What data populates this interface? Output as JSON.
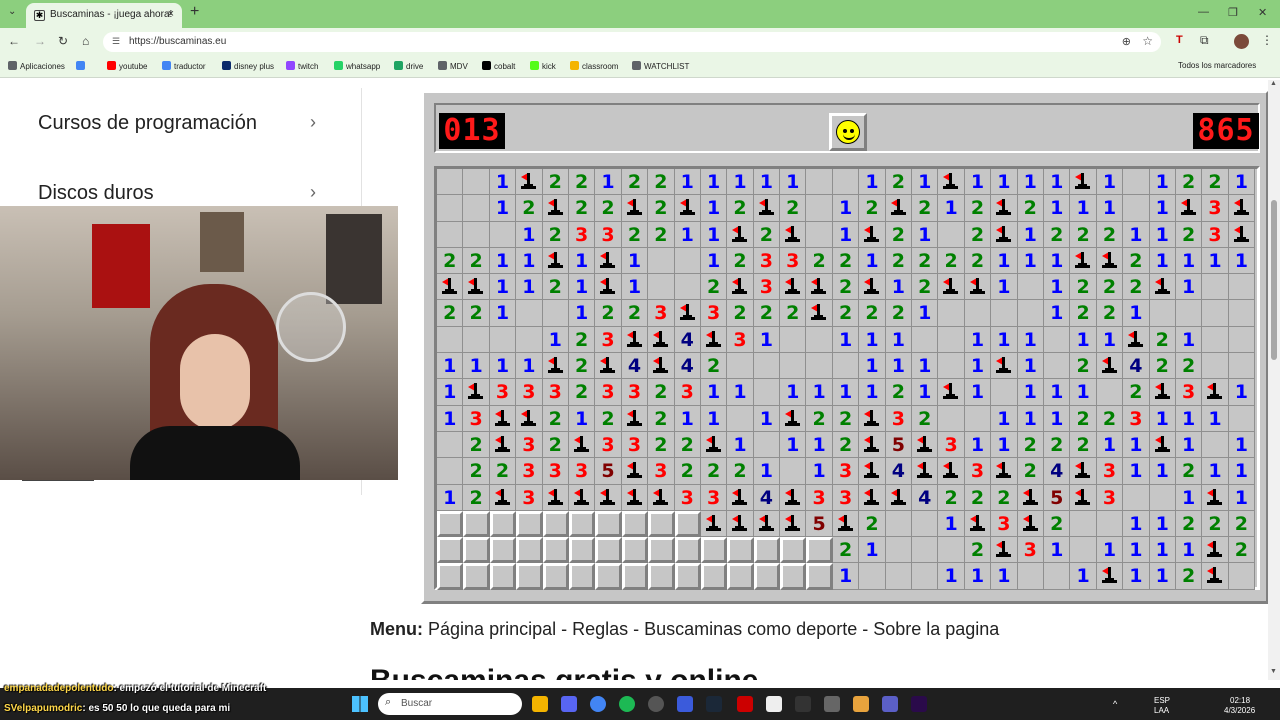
{
  "browser": {
    "tab_title": "Buscaminas - ¡juega ahora!",
    "tab_close": "×",
    "new_tab": "+",
    "url": "https://buscaminas.eu",
    "bookmarks": [
      {
        "label": "Aplicaciones",
        "color": "#5f6368"
      },
      {
        "label": "",
        "color": "#4285f4"
      },
      {
        "label": "youtube",
        "color": "#ff0000"
      },
      {
        "label": "traductor",
        "color": "#4285f4"
      },
      {
        "label": "disney plus",
        "color": "#0b2a6b"
      },
      {
        "label": "twitch",
        "color": "#9146ff"
      },
      {
        "label": "whatsapp",
        "color": "#25d366"
      },
      {
        "label": "drive",
        "color": "#1fa463"
      },
      {
        "label": "MDV",
        "color": "#5f6368"
      },
      {
        "label": "cobalt",
        "color": "#000000"
      },
      {
        "label": "kick",
        "color": "#53fc18"
      },
      {
        "label": "classroom",
        "color": "#f4b400"
      },
      {
        "label": "WATCHLIST",
        "color": "#5f6368"
      }
    ],
    "all_bookmarks": "Todos los marcadores"
  },
  "sidebar": {
    "items": [
      {
        "label": "Cursos de programación",
        "chevron": "›"
      },
      {
        "label": "Discos duros",
        "chevron": "›"
      }
    ]
  },
  "game": {
    "mine_counter": "013",
    "timer": "865",
    "face": "smiley",
    "columns": 31,
    "rows": 16,
    "legend": "F = flag, . = revealed empty, # = unrevealed, digits = adjacent mine count",
    "board": [
      "..1F2212211111..121F1111F1.1221",
      "..12F22F2F12F2.12F212F2111.1F3F",
      "...12332211F2F.1F21.2F12221123F2",
      "2211F1F1..12332212222111FF21111",
      "FF1121F1..2F3FF2F12FF1.1222F1..",
      "221..1223F3222F2221....1221...",
      "....123FF4F31..111..111.11F21..",
      "1111F2F4F42.....111.1F1.2F422..",
      "1F3332332311.111121F1.111.2F3F1.",
      "13FF212F211.1F22F32..111223111",
      ".2F32F3322F1.112F5F31122211F1.1F",
      ".223335F32221.13F4FF3F24F3112112",
      "12F3FFFFF33F4F33FF4222F5F3..1F11F",
      "##########FFFF5F2..1F3F2..11222",
      "###############21...2F31.1111F2",
      "###############1...111..1F112F"
    ]
  },
  "page": {
    "menu_label": "Menu:",
    "menu_links": "Página principal - Reglas - Buscaminas como deporte - Sobre la pagina",
    "heading_partial": "Buscaminas gratis y online"
  },
  "chat": [
    {
      "user": "empanadadepolentudo",
      "text": ": empezó el tutorial de Minecraft"
    },
    {
      "user": "SVelpapumodric",
      "text": ": es 50 50 lo que queda para mi"
    }
  ],
  "taskbar": {
    "search_placeholder": "Buscar",
    "lang_line1": "ESP",
    "lang_line2": "LAA",
    "time": "02:18",
    "date": "4/3/2026"
  }
}
